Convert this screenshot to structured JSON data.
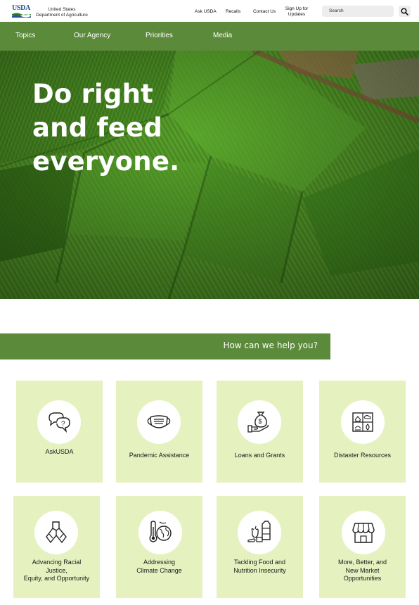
{
  "header": {
    "logo_text": "USDA",
    "org_line1": "United States",
    "org_line2": "Department of Agriculture",
    "links": [
      "Ask USDA",
      "Recalls",
      "Contact Us"
    ],
    "signup_line1": "Sign Up for",
    "signup_line2": "Updates",
    "search_placeholder": "Search",
    "search_button_icon": "magnifier-icon"
  },
  "nav": {
    "items": [
      "Topics",
      "Our Agency",
      "Priorities",
      "Media"
    ]
  },
  "hero": {
    "line1": "Do right",
    "line2": "and feed",
    "line3": "everyone."
  },
  "help": {
    "heading": "How can we help you?"
  },
  "cards": [
    {
      "icon": "speech-bubbles-icon",
      "lines": [
        "AskUSDA"
      ]
    },
    {
      "icon": "face-mask-icon",
      "lines": [
        "Pandemic Assistance"
      ]
    },
    {
      "icon": "money-bag-hand-icon",
      "lines": [
        "Loans and Grants"
      ]
    },
    {
      "icon": "disaster-icon",
      "lines": [
        "Distaster Resources"
      ]
    },
    {
      "icon": "joined-hands-icon",
      "lines": [
        "Advancing Racial",
        "Justice,",
        "Equity, and Opportunity"
      ]
    },
    {
      "icon": "thermometer-globe-icon",
      "lines": [
        "Addressing",
        "Climate Change"
      ]
    },
    {
      "icon": "groceries-icon",
      "lines": [
        "Tackling Food and",
        "Nutrition Insecurity"
      ]
    },
    {
      "icon": "market-stall-icon",
      "lines": [
        "More, Better, and",
        "New Market",
        "Opportunities"
      ]
    }
  ],
  "colors": {
    "accent_green": "#5b8a3a",
    "card_bg": "#e5f2c0",
    "logo_blue": "#205493"
  }
}
